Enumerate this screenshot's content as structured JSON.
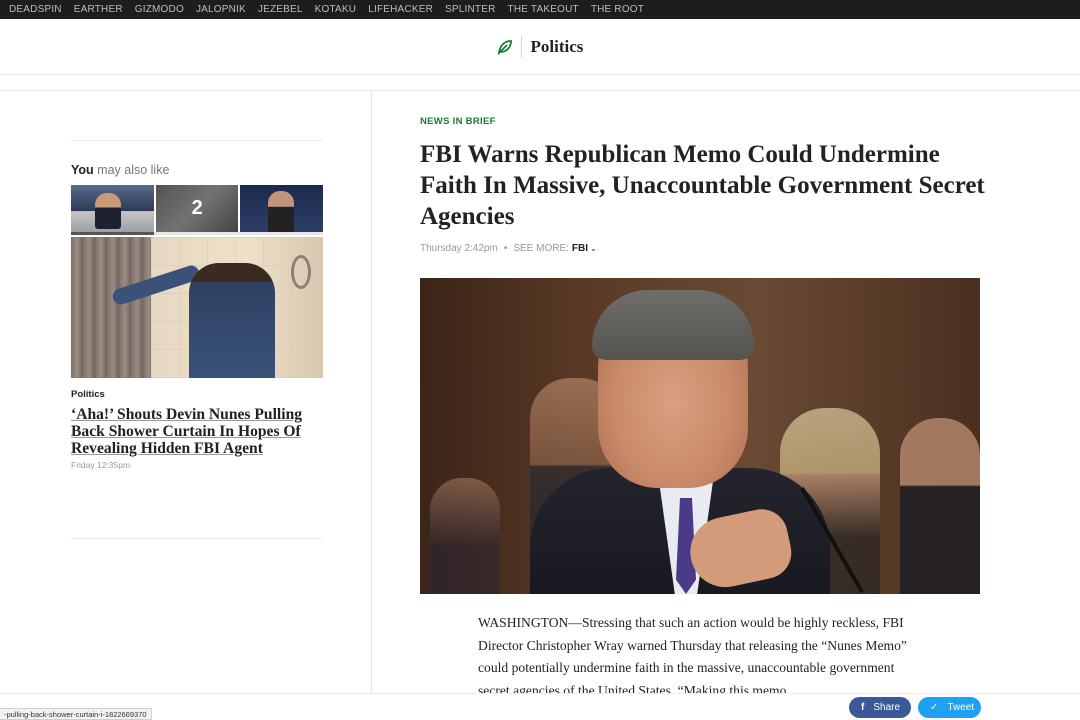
{
  "network_nav": [
    "DEADSPIN",
    "EARTHER",
    "GIZMODO",
    "JALOPNIK",
    "JEZEBEL",
    "KOTAKU",
    "LIFEHACKER",
    "SPLINTER",
    "THE TAKEOUT",
    "THE ROOT"
  ],
  "masthead": {
    "section_title": "Politics",
    "logo_icon": "onion-leaf-icon",
    "brand_color": "#1b7a3a"
  },
  "sidebar": {
    "also_like_bold": "You",
    "also_like_rest": " may also like",
    "thumb_count": "2",
    "story": {
      "kicker": "Politics",
      "headline": "‘Aha!’ Shouts Devin Nunes Pulling Back Shower Curtain In Hopes Of Revealing Hidden FBI Agent",
      "time": "Friday 12:35pm"
    }
  },
  "article": {
    "kicker": "NEWS IN BRIEF",
    "headline": "FBI Warns Republican Memo Could Undermine Faith In Massive, Unaccountable Government Secret Agencies",
    "timestamp": "Thursday 2:42pm",
    "see_more_label": "SEE MORE:",
    "tag": "FBI",
    "body": "WASHINGTON—Stressing that such an action would be highly reckless, FBI Director Christopher Wray warned Thursday that releasing the “Nunes Memo” could potentially undermine faith in the massive, unaccountable government secret agencies of the United States. “Making this memo"
  },
  "share_bar": {
    "facebook_label": "Share",
    "twitter_label": "Tweet"
  },
  "status_url": "-pulling-back-shower-curtain-i-1822669370"
}
